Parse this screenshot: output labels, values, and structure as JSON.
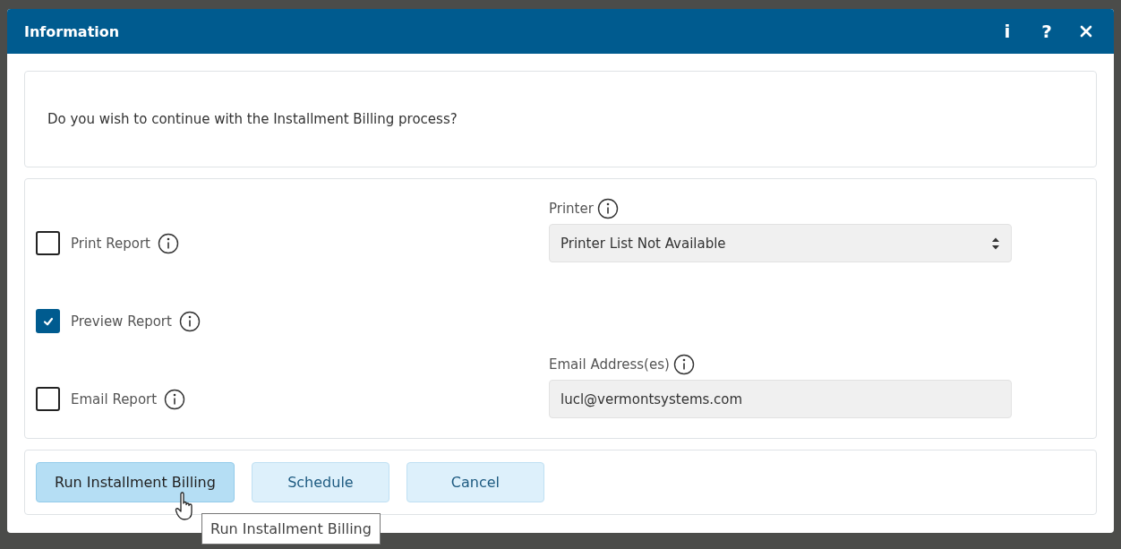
{
  "dialog": {
    "title": "Information",
    "header_buttons": [
      {
        "kind": "info",
        "label": "i"
      },
      {
        "kind": "help",
        "label": "?"
      },
      {
        "kind": "close"
      }
    ]
  },
  "message": "Do you wish to continue with the Installment Billing process?",
  "options": [
    {
      "label": "Print Report",
      "checked": false,
      "field": {
        "kind": "select",
        "label": "Printer",
        "value": "Printer List Not Available"
      }
    },
    {
      "label": "Preview Report",
      "checked": true
    },
    {
      "label": "Email Report",
      "checked": false,
      "field": {
        "kind": "text",
        "label": "Email Address(es)",
        "value": "lucl@vermontsystems.com"
      }
    }
  ],
  "buttons": [
    {
      "label": "Run Installment Billing",
      "hovered": true
    },
    {
      "label": "Schedule",
      "hovered": false
    },
    {
      "label": "Cancel",
      "hovered": false
    }
  ],
  "tooltip": {
    "text": "Run Installment Billing"
  }
}
